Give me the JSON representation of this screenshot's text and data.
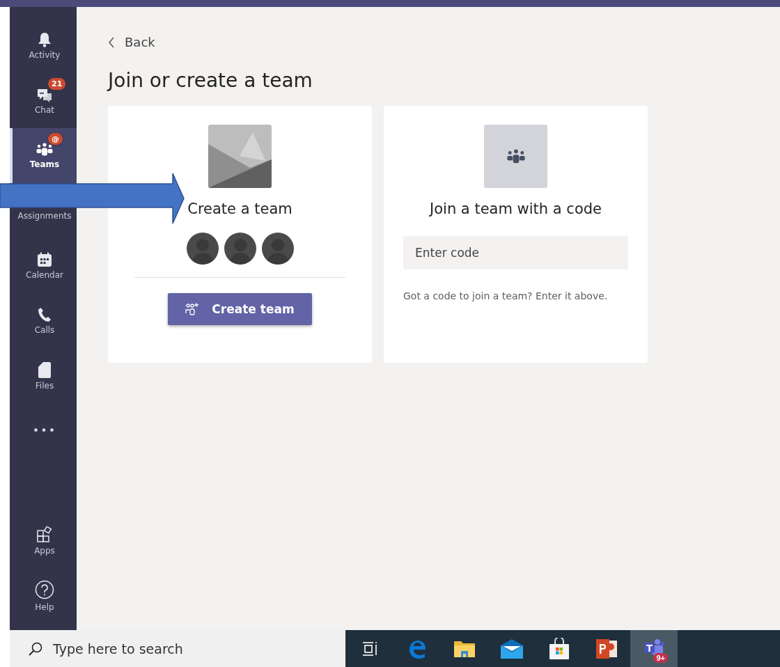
{
  "sidebar": {
    "items": [
      {
        "label": "Activity",
        "kind": "bell",
        "selected": false
      },
      {
        "label": "Chat",
        "kind": "chat",
        "selected": false,
        "badge": "21"
      },
      {
        "label": "Teams",
        "kind": "teams",
        "selected": true,
        "badge": "@"
      },
      {
        "label": "Assignments",
        "kind": "assignments",
        "selected": false
      },
      {
        "label": "Calendar",
        "kind": "calendar",
        "selected": false
      },
      {
        "label": "Calls",
        "kind": "calls",
        "selected": false
      },
      {
        "label": "Files",
        "kind": "files",
        "selected": false
      },
      {
        "label": "•••",
        "kind": "more",
        "selected": false
      }
    ],
    "bottom_items": [
      {
        "label": "Apps",
        "kind": "apps",
        "selected": false
      },
      {
        "label": "Help",
        "kind": "help",
        "selected": false
      }
    ]
  },
  "back": "Back",
  "title": "Join or create a team",
  "cards": [
    {
      "kind": "create",
      "heading": "Create a team",
      "button": "Create team"
    },
    {
      "kind": "join",
      "heading": "Join a team with a code",
      "placeholder": "Enter code",
      "hint": "Got a code to join a team? Enter it above."
    }
  ],
  "taskbar": {
    "search_placeholder": "Type here to search",
    "apps": [
      {
        "kind": "taskview",
        "selected": false
      },
      {
        "kind": "edge",
        "selected": false
      },
      {
        "kind": "explorer",
        "selected": false
      },
      {
        "kind": "mail",
        "selected": false
      },
      {
        "kind": "store",
        "selected": false
      },
      {
        "kind": "powerpoint",
        "selected": false
      },
      {
        "kind": "teams",
        "selected": true,
        "badge": "9+"
      }
    ]
  }
}
